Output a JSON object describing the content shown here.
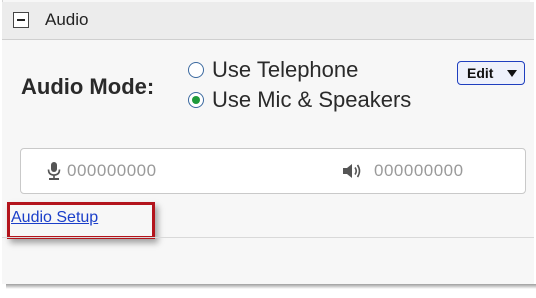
{
  "header": {
    "title": "Audio",
    "collapse_icon": "minus-icon"
  },
  "audio_mode": {
    "label": "Audio Mode:",
    "options": [
      {
        "label": "Use Telephone",
        "selected": false
      },
      {
        "label": "Use Mic & Speakers",
        "selected": true
      }
    ],
    "edit_button": {
      "label": "Edit",
      "icon": "caret-down-icon"
    }
  },
  "devices": {
    "mic": {
      "icon": "microphone-icon",
      "value": "000000000"
    },
    "speaker": {
      "icon": "speaker-icon",
      "value": "000000000"
    }
  },
  "audio_setup_link": {
    "label": "Audio Setup"
  },
  "colors": {
    "link": "#1a3ec9",
    "highlight": "#b3141c",
    "radio_selected": "#1e9a3a",
    "edit_border": "#1f3fbf"
  }
}
